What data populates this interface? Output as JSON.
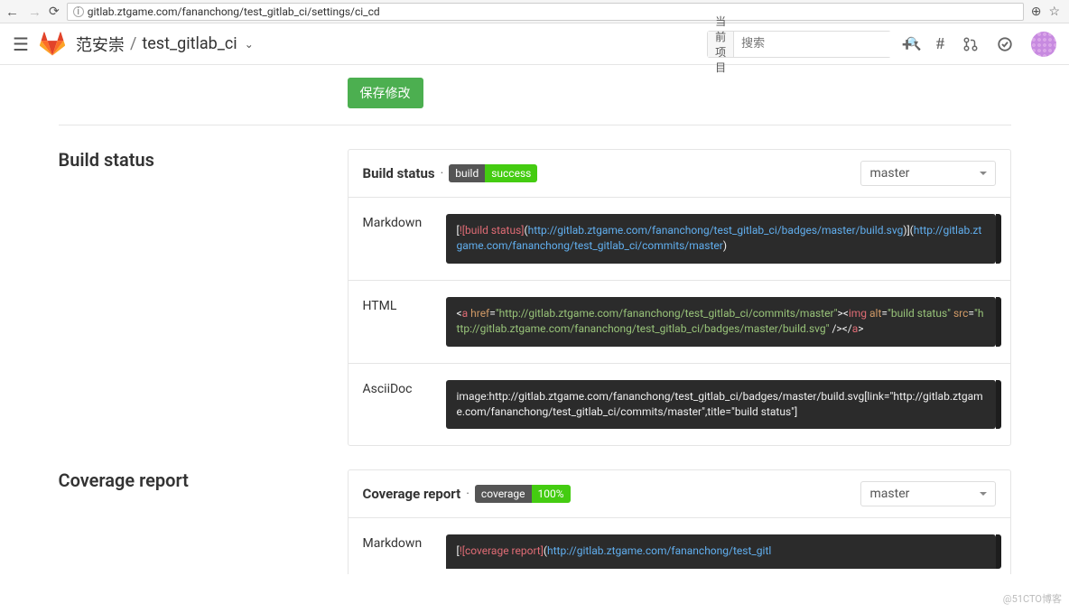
{
  "browser": {
    "url": "gitlab.ztgame.com/fananchong/test_gitlab_ci/settings/ci_cd"
  },
  "header": {
    "group": "范安崇",
    "project": "test_gitlab_ci",
    "search_prefix": "当前项目",
    "search_placeholder": "搜索"
  },
  "save_button": "保存修改",
  "build_status": {
    "heading": "Build status",
    "panel_title": "Build status",
    "badge_left": "build",
    "badge_right": "success",
    "badge_right_color": "#4c1",
    "branch": "master",
    "rows": {
      "markdown": {
        "label": "Markdown",
        "segments": [
          {
            "cls": "t-o",
            "text": "["
          },
          {
            "cls": "t-r",
            "text": "![build status]"
          },
          {
            "cls": "t-o",
            "text": "("
          },
          {
            "cls": "t-b",
            "text": "http://gitlab.ztgame.com/fananchong/test_gitlab_ci/badges/master/build.svg"
          },
          {
            "cls": "t-o",
            "text": ")]("
          },
          {
            "cls": "t-b",
            "text": "http://gitlab.ztgame.com/fananchong/test_gitlab_ci/commits/master"
          },
          {
            "cls": "t-o",
            "text": ")"
          }
        ]
      },
      "html": {
        "label": "HTML",
        "segments": [
          {
            "cls": "t-o",
            "text": "<"
          },
          {
            "cls": "t-r",
            "text": "a "
          },
          {
            "cls": "t-y",
            "text": "href"
          },
          {
            "cls": "t-o",
            "text": "="
          },
          {
            "cls": "t-g",
            "text": "\"http://gitlab.ztgame.com/fananchong/test_gitlab_ci/commits/master\""
          },
          {
            "cls": "t-o",
            "text": "><"
          },
          {
            "cls": "t-r",
            "text": "img "
          },
          {
            "cls": "t-y",
            "text": "alt"
          },
          {
            "cls": "t-o",
            "text": "="
          },
          {
            "cls": "t-g",
            "text": "\"build status\" "
          },
          {
            "cls": "t-y",
            "text": "src"
          },
          {
            "cls": "t-o",
            "text": "="
          },
          {
            "cls": "t-g",
            "text": "\"http://gitlab.ztgame.com/fananchong/test_gitlab_ci/badges/master/build.svg\""
          },
          {
            "cls": "t-o",
            "text": " /></"
          },
          {
            "cls": "t-r",
            "text": "a"
          },
          {
            "cls": "t-o",
            "text": ">"
          }
        ]
      },
      "asciidoc": {
        "label": "AsciiDoc",
        "segments": [
          {
            "cls": "t-o",
            "text": "image:http://gitlab.ztgame.com/fananchong/test_gitlab_ci/badges/master/build.svg[link=\"http://gitlab.ztgame.com/fananchong/test_gitlab_ci/commits/master\",title=\"build status\"]"
          }
        ]
      }
    }
  },
  "coverage": {
    "heading": "Coverage report",
    "panel_title": "Coverage report",
    "badge_left": "coverage",
    "badge_right": "100%",
    "badge_right_color": "#4c1",
    "branch": "master",
    "rows": {
      "markdown": {
        "label": "Markdown",
        "segments": [
          {
            "cls": "t-o",
            "text": "["
          },
          {
            "cls": "t-r",
            "text": "![coverage report]"
          },
          {
            "cls": "t-o",
            "text": "("
          },
          {
            "cls": "t-b",
            "text": "http://gitlab.ztgame.com/fananchong/test_gitl"
          }
        ]
      }
    }
  },
  "watermark": "@51CTO博客"
}
